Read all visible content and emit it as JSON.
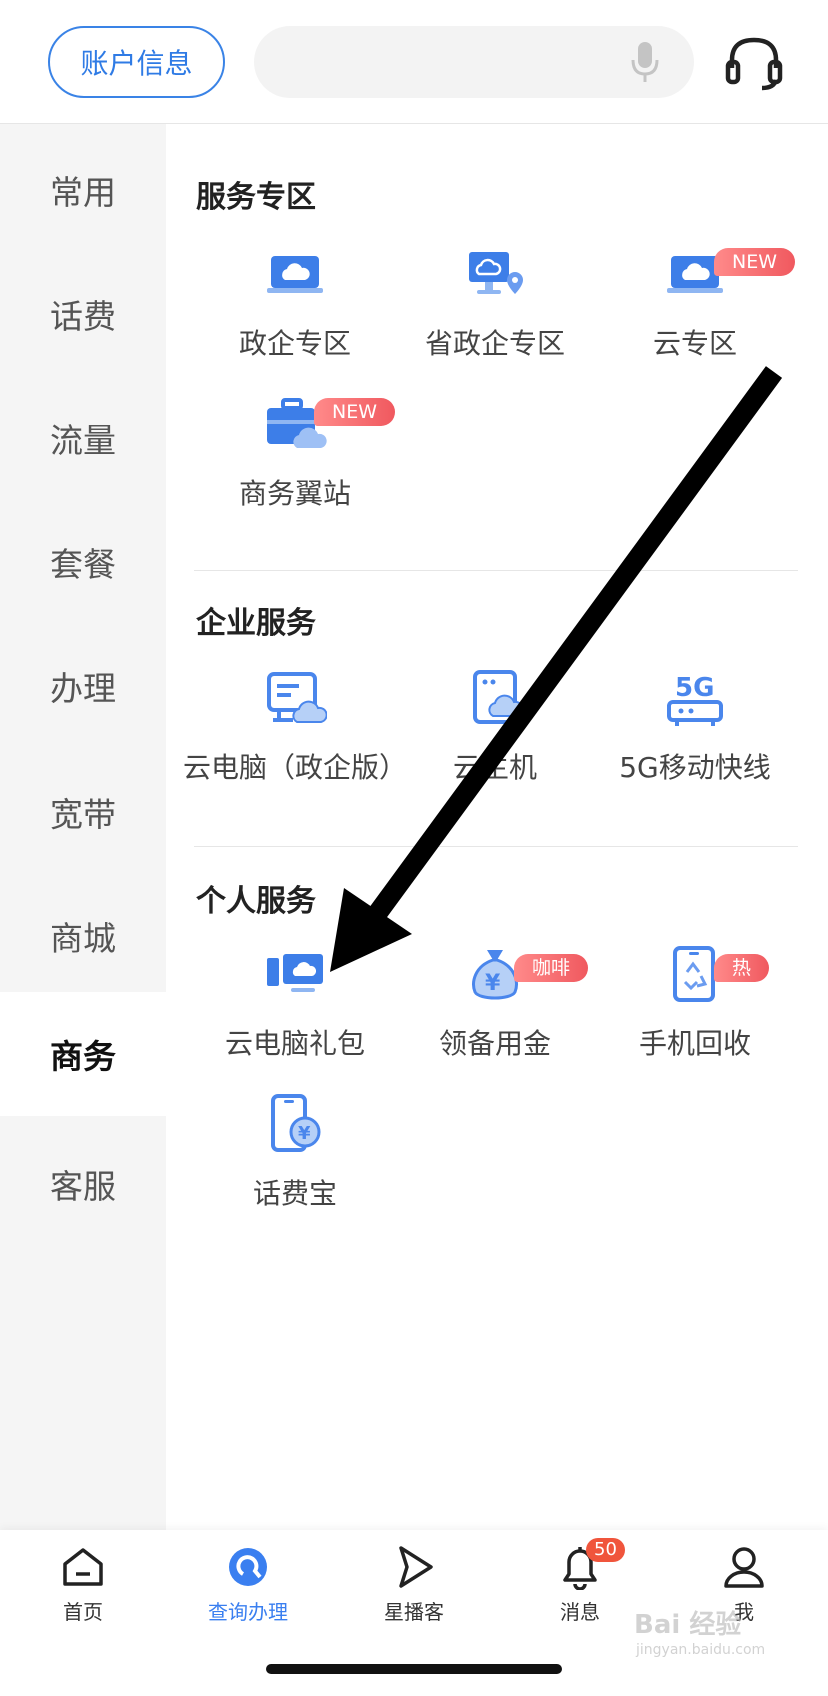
{
  "header": {
    "account_button": "账户信息",
    "search_placeholder": "",
    "icons": {
      "mic": "mic-icon",
      "service": "headset-icon"
    }
  },
  "sidebar": {
    "items": [
      {
        "label": "常用"
      },
      {
        "label": "话费"
      },
      {
        "label": "流量"
      },
      {
        "label": "套餐"
      },
      {
        "label": "办理"
      },
      {
        "label": "宽带"
      },
      {
        "label": "商城"
      },
      {
        "label": "商务",
        "active": true
      },
      {
        "label": "客服"
      }
    ]
  },
  "sections": [
    {
      "title": "服务专区",
      "items": [
        {
          "label": "政企专区",
          "icon": "laptop-cloud-icon"
        },
        {
          "label": "省政企专区",
          "icon": "monitor-location-icon"
        },
        {
          "label": "云专区",
          "icon": "laptop-cloud-icon",
          "badge": "NEW"
        },
        {
          "label": "商务翼站",
          "icon": "briefcase-cloud-icon",
          "badge": "NEW"
        }
      ]
    },
    {
      "title": "企业服务",
      "items": [
        {
          "label": "云电脑（政企版）",
          "icon": "cloud-computer-icon"
        },
        {
          "label": "云主机",
          "icon": "cloud-host-icon"
        },
        {
          "label": "5G移动快线",
          "icon": "5g-router-icon"
        }
      ]
    },
    {
      "title": "个人服务",
      "items": [
        {
          "label": "云电脑礼包",
          "icon": "desktop-cloud-icon"
        },
        {
          "label": "领备用金",
          "icon": "money-bag-icon",
          "badge": "咖啡"
        },
        {
          "label": "手机回收",
          "icon": "phone-recycle-icon",
          "badge": "热"
        },
        {
          "label": "话费宝",
          "icon": "phone-coin-icon"
        }
      ]
    }
  ],
  "bottom_nav": [
    {
      "label": "首页",
      "icon": "home-icon"
    },
    {
      "label": "查询办理",
      "icon": "query-icon",
      "active": true
    },
    {
      "label": "星播客",
      "icon": "play-icon"
    },
    {
      "label": "消息",
      "icon": "bell-icon",
      "badge": "50"
    },
    {
      "label": "我",
      "icon": "user-icon"
    }
  ],
  "watermark": {
    "text": "Bai 经验",
    "sub": "jingyan.baidu.com"
  },
  "colors": {
    "accent": "#3a7ff0",
    "badge": "#f0595f",
    "icon_blue": "#4a86ec"
  }
}
